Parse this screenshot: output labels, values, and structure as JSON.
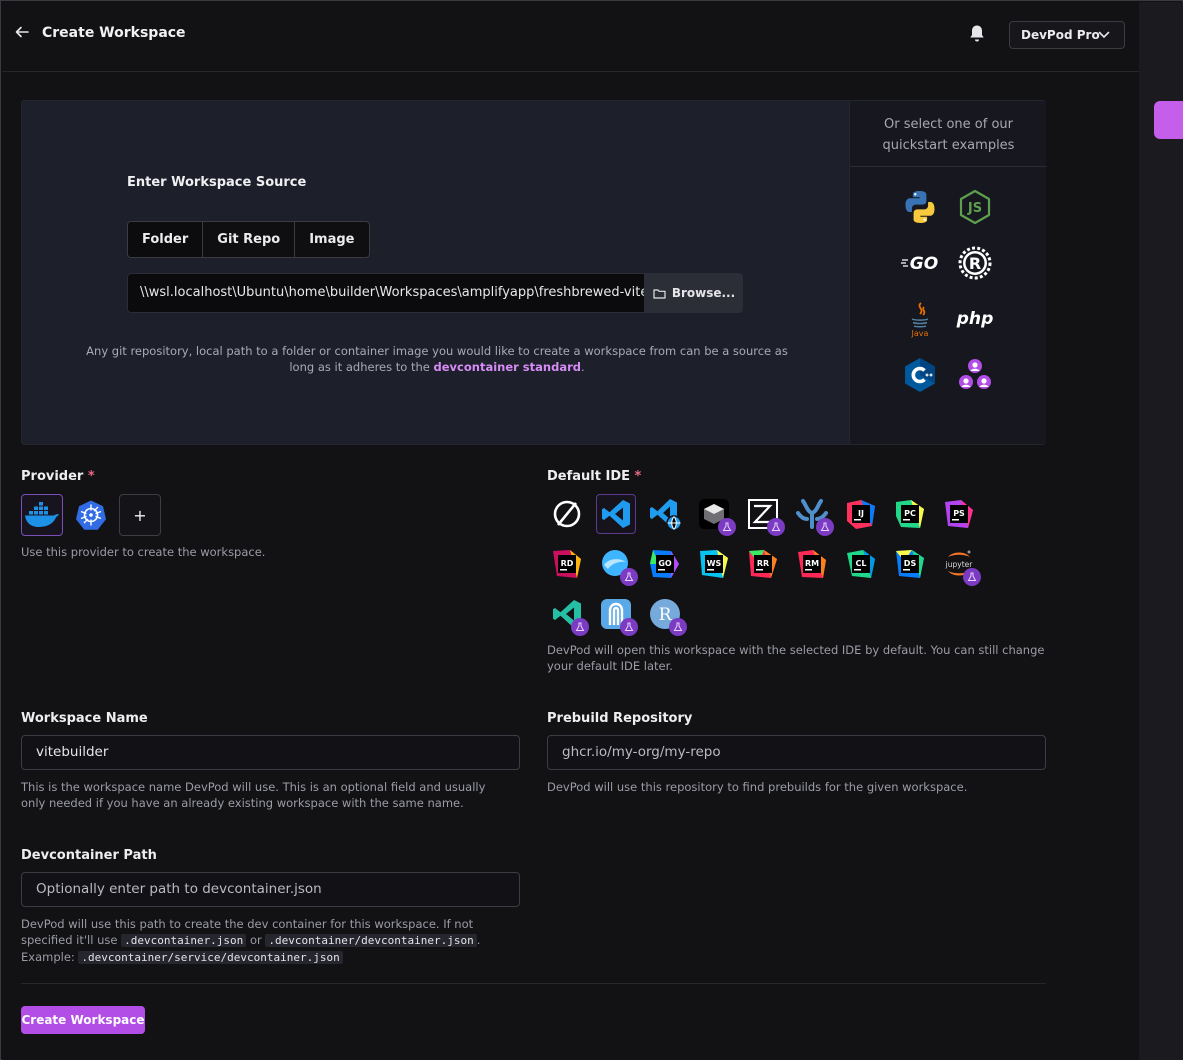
{
  "header": {
    "title": "Create Workspace",
    "dropdown_label": "DevPod Pro"
  },
  "source": {
    "label": "Enter Workspace Source",
    "tabs": [
      "Folder",
      "Git Repo",
      "Image"
    ],
    "path_value": "\\\\wsl.localhost\\Ubuntu\\home\\builder\\Workspaces\\amplifyapp\\freshbrewed-vite",
    "browse_label": "Browse...",
    "help_prefix": "Any git repository, local path to a folder or container image you would like to create a workspace from can be a source as long as it adheres to the ",
    "help_link": "devcontainer standard",
    "help_suffix": "."
  },
  "quickstart": {
    "title": "Or select one of our quickstart examples",
    "examples": [
      "python-icon",
      "nodejs-icon",
      "go-icon",
      "rust-icon",
      "java-icon",
      "php-icon",
      "cpp-icon",
      "community-icon"
    ],
    "go_text": "GO",
    "php_text": "php",
    "java_text": "Java"
  },
  "provider": {
    "label": "Provider",
    "required_mark": "*",
    "add_label": "+",
    "help": "Use this provider to create the workspace."
  },
  "ide": {
    "label": "Default IDE",
    "required_mark": "*",
    "help": "DevPod will open this workspace with the selected IDE by default. You can still change your default IDE later.",
    "items": [
      {
        "name": "none",
        "text": ""
      },
      {
        "name": "vscode",
        "text": ""
      },
      {
        "name": "vscode-browser",
        "text": ""
      },
      {
        "name": "openvscode",
        "text": ""
      },
      {
        "name": "zed",
        "text": ""
      },
      {
        "name": "positron",
        "text": ""
      },
      {
        "name": "intellij",
        "text": "IJ"
      },
      {
        "name": "pycharm",
        "text": "PC"
      },
      {
        "name": "phpstorm",
        "text": "PS"
      },
      {
        "name": "rider",
        "text": "RD"
      },
      {
        "name": "fleet",
        "text": ""
      },
      {
        "name": "goland",
        "text": "GO"
      },
      {
        "name": "webstorm",
        "text": "WS"
      },
      {
        "name": "rustrover",
        "text": "RR"
      },
      {
        "name": "rubymine",
        "text": "RM"
      },
      {
        "name": "clion",
        "text": "CL"
      },
      {
        "name": "dataspell",
        "text": "DS"
      },
      {
        "name": "jupyter",
        "text": "jupyter"
      },
      {
        "name": "vscode-insiders",
        "text": ""
      },
      {
        "name": "cursor",
        "text": ""
      },
      {
        "name": "rstudio",
        "text": "R"
      }
    ]
  },
  "workspace_name": {
    "label": "Workspace Name",
    "value": "vitebuilder",
    "help": "This is the workspace name DevPod will use. This is an optional field and usually only needed if you have an already existing workspace with the same name."
  },
  "prebuild": {
    "label": "Prebuild Repository",
    "placeholder": "ghcr.io/my-org/my-repo",
    "help": "DevPod will use this repository to find prebuilds for the given workspace."
  },
  "devcontainer": {
    "label": "Devcontainer Path",
    "placeholder": "Optionally enter path to devcontainer.json",
    "help_1": "DevPod will use this path to create the dev container for this workspace. If not specified it'll use ",
    "code_1": ".devcontainer.json",
    "or": " or ",
    "code_2": ".devcontainer/devcontainer.json",
    "period": ".",
    "example_label": "Example: ",
    "code_3": ".devcontainer/service/devcontainer.json"
  },
  "submit_label": "Create Workspace",
  "colors": {
    "accent": "#b24ee6",
    "link": "#d68cf5",
    "required": "#e66a82"
  }
}
